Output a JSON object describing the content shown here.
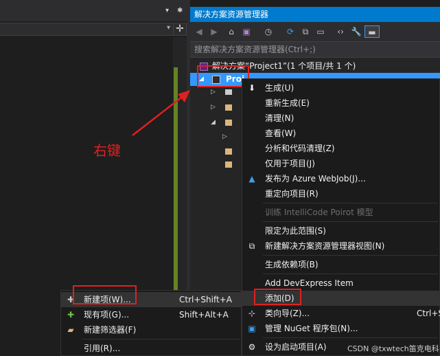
{
  "left": {
    "dropdown_arrow": "▾",
    "gear": "✱",
    "combo_arrow": "▾",
    "split_icon": "✛"
  },
  "solution_explorer": {
    "title": "解决方案资源管理器",
    "search_placeholder": "搜索解决方案资源管理器(Ctrl+;)",
    "toolbar": [
      "◀",
      "▶",
      "⌂",
      "▣",
      "◷",
      "⟳",
      "⧉",
      "▭",
      "‹›",
      "🔧",
      "▬"
    ],
    "tree": {
      "solution_label": "解决方案“Project1”(1 个项目/共 1 个)",
      "project_label": "Proj",
      "expand_open": "◢",
      "expand_closed": "▷"
    }
  },
  "annotation": {
    "text": "右键",
    "color": "#e02020"
  },
  "context_menu": {
    "items": [
      {
        "label": "生成(U)",
        "icon": "⬇"
      },
      {
        "label": "重新生成(E)",
        "icon": ""
      },
      {
        "label": "清理(N)",
        "icon": ""
      },
      {
        "label": "查看(W)",
        "icon": ""
      },
      {
        "label": "分析和代码清理(Z)",
        "icon": ""
      },
      {
        "label": "仅用于项目(J)",
        "icon": ""
      },
      {
        "label": "发布为 Azure WebJob(J)...",
        "icon": "▲"
      },
      {
        "label": "重定向项目(R)",
        "icon": ""
      },
      {
        "label": "训练 IntelliCode Poirot 模型",
        "icon": ""
      },
      {
        "label": "限定为此范围(S)",
        "icon": ""
      },
      {
        "label": "新建解决方案资源管理器视图(N)",
        "icon": "⧉"
      },
      {
        "label": "生成依赖项(B)",
        "icon": ""
      },
      {
        "label": "Add DevExpress Item",
        "icon": ""
      },
      {
        "label": "添加(D)",
        "icon": ""
      },
      {
        "label": "类向导(Z)...",
        "icon": "⊹",
        "shortcut": "Ctrl+S"
      },
      {
        "label": "管理 NuGet 程序包(N)...",
        "icon": "▣"
      },
      {
        "label": "设为启动项目(A)",
        "icon": "⚙"
      }
    ]
  },
  "add_submenu": {
    "items": [
      {
        "label": "新建项(W)...",
        "shortcut": "Ctrl+Shift+A",
        "icon": "✚"
      },
      {
        "label": "现有项(G)...",
        "shortcut": "Shift+Alt+A",
        "icon": "✚"
      },
      {
        "label": "新建筛选器(F)",
        "shortcut": "",
        "icon": "▰"
      },
      {
        "label": "引用(R)...",
        "shortcut": "",
        "icon": ""
      }
    ]
  },
  "watermark": "CSDN @txwtech笛克电科"
}
